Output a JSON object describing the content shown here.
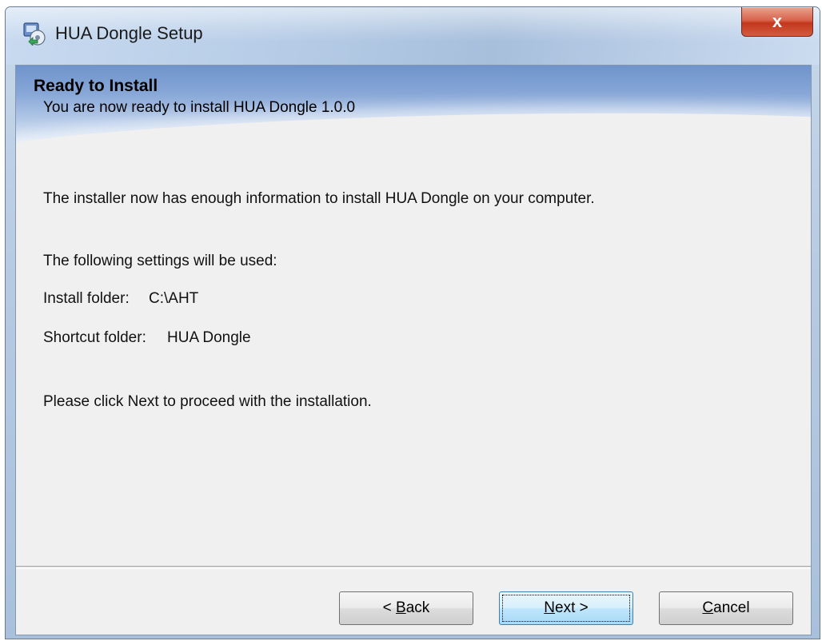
{
  "window": {
    "title": "HUA Dongle Setup",
    "close_glyph": "x",
    "icon": "setup-icon"
  },
  "banner": {
    "title": "Ready to Install",
    "subtitle": "You are now ready to install HUA Dongle 1.0.0"
  },
  "body": {
    "intro": "The installer now has enough information to install HUA Dongle on your computer.",
    "settings_heading": "The following settings will be used:",
    "install_folder_label": "Install folder:",
    "install_folder_value": "C:\\AHT",
    "shortcut_folder_label": "Shortcut folder:",
    "shortcut_folder_value": "HUA Dongle",
    "instruction": "Please click Next to proceed with the installation."
  },
  "buttons": {
    "back": {
      "prefix": "< ",
      "mnemonic": "B",
      "rest": "ack"
    },
    "next": {
      "mnemonic": "N",
      "rest": "ext >"
    },
    "cancel": {
      "mnemonic": "C",
      "rest": "ancel"
    }
  },
  "colors": {
    "close_red": "#c3371d",
    "default_button_border": "#3c7fb1",
    "banner_blue": "#6f94cc"
  }
}
